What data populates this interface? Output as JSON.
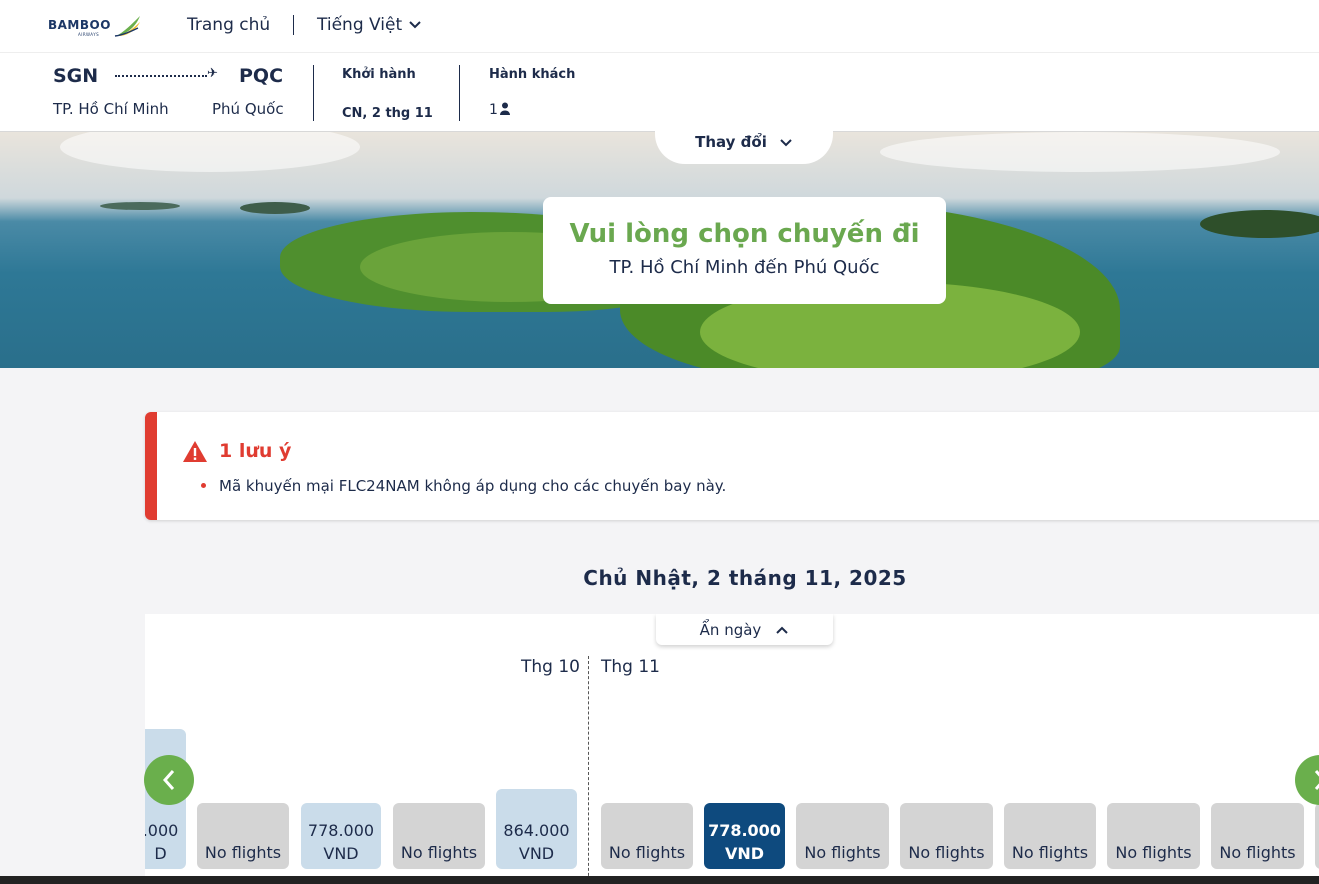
{
  "brand": {
    "logo_text": "BAMBOO",
    "logo_sub": "AIRWAYS"
  },
  "nav": {
    "home": "Trang chủ",
    "language": "Tiếng Việt"
  },
  "summary": {
    "origin_code": "SGN",
    "origin_city": "TP. Hồ Chí Minh",
    "dest_code": "PQC",
    "dest_city": "Phú Quốc",
    "depart_label": "Khởi hành",
    "depart_value": "CN, 2 thg 11",
    "pax_label": "Hành khách",
    "pax_value": "1"
  },
  "change_button": "Thay đổi",
  "hero": {
    "title": "Vui lòng chọn chuyến đi",
    "subtitle": "TP. Hồ Chí Minh đến Phú Quốc"
  },
  "alert": {
    "title": "1 lưu ý",
    "items": [
      "Mã khuyến mại FLC24NAM không áp dụng cho các chuyến bay này."
    ]
  },
  "date_heading": "Chủ Nhật, 2 tháng 11, 2025",
  "calendar": {
    "hide_label": "Ẩn ngày",
    "months": [
      "Thg 10",
      "Thg 11"
    ],
    "days": [
      {
        "line1": ".000",
        "line2": "D",
        "state": "price"
      },
      {
        "text": "No flights",
        "state": "none"
      },
      {
        "line1": "778.000",
        "line2": "VND",
        "state": "price"
      },
      {
        "text": "No flights",
        "state": "none"
      },
      {
        "line1": "864.000",
        "line2": "VND",
        "state": "price"
      },
      {
        "text": "No flights",
        "state": "none"
      },
      {
        "line1": "778.000",
        "line2": "VND",
        "state": "selected"
      },
      {
        "text": "No flights",
        "state": "none"
      },
      {
        "text": "No flights",
        "state": "none"
      },
      {
        "text": "No flights",
        "state": "none"
      },
      {
        "text": "No flights",
        "state": "none"
      },
      {
        "text": "No flights",
        "state": "none"
      }
    ]
  },
  "colors": {
    "accent_green": "#6aa84f",
    "alert_red": "#e03c31",
    "selected_blue": "#0e4a7e",
    "navy_text": "#1d2b4a"
  }
}
